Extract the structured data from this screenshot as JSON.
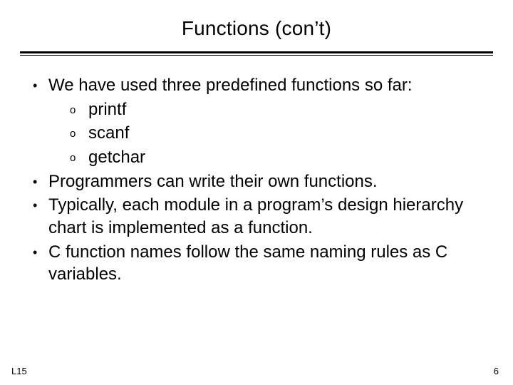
{
  "title": "Functions (con’t)",
  "bullets": {
    "b0": "We have used three predefined functions so far:",
    "b0_subs": {
      "s0": "printf",
      "s1": "scanf",
      "s2": "getchar"
    },
    "b1": "Programmers can write their own functions.",
    "b2": "Typically, each module in a program’s design hierarchy chart is implemented as a function.",
    "b3": "C function names follow the same naming rules as C variables."
  },
  "footer": {
    "left": "L15",
    "right": "6"
  }
}
